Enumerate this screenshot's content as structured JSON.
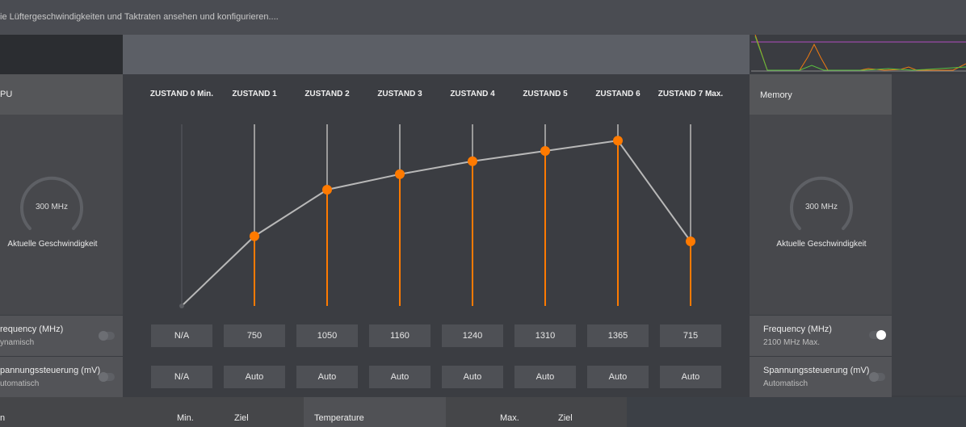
{
  "header": {
    "subtitle": "ie Lüftergeschwindigkeiten und Taktraten ansehen und konfigurieren...."
  },
  "gpu_panel": {
    "title": "PU",
    "gauge_value": "300 MHz",
    "gauge_label": "Aktuelle Geschwindigkeit",
    "frequency": {
      "title": "requency (MHz)",
      "sub": "ynamisch",
      "toggle_on": false
    },
    "voltage": {
      "title": "pannungssteuerung (mV)",
      "sub": "utomatisch",
      "toggle_on": false
    }
  },
  "memory_panel": {
    "title": "Memory",
    "gauge_value": "300 MHz",
    "gauge_label": "Aktuelle Geschwindigkeit",
    "frequency": {
      "title": "Frequency (MHz)",
      "sub": "2100 MHz Max.",
      "toggle_on": true
    },
    "voltage": {
      "title": "Spannungssteuerung (mV)",
      "sub": "Automatisch",
      "toggle_on": false
    }
  },
  "states": [
    {
      "label": "ZUSTAND 0 Min.",
      "frequency": "N/A",
      "voltage": "N/A",
      "level": 0.0,
      "active": false
    },
    {
      "label": "ZUSTAND 1",
      "frequency": "750",
      "voltage": "Auto",
      "level": 0.27,
      "active": true
    },
    {
      "label": "ZUSTAND 2",
      "frequency": "1050",
      "voltage": "Auto",
      "level": 0.45,
      "active": true
    },
    {
      "label": "ZUSTAND 3",
      "frequency": "1160",
      "voltage": "Auto",
      "level": 0.51,
      "active": true
    },
    {
      "label": "ZUSTAND 4",
      "frequency": "1240",
      "voltage": "Auto",
      "level": 0.56,
      "active": true
    },
    {
      "label": "ZUSTAND 5",
      "frequency": "1310",
      "voltage": "Auto",
      "level": 0.6,
      "active": true
    },
    {
      "label": "ZUSTAND 6",
      "frequency": "1365",
      "voltage": "Auto",
      "level": 0.64,
      "active": true
    },
    {
      "label": "ZUSTAND 7 Max.",
      "frequency": "715",
      "voltage": "Auto",
      "level": 0.25,
      "active": true
    }
  ],
  "bottom": {
    "left_label": "n",
    "min_label": "Min.",
    "target_label": "Ziel",
    "temperature_label": "Temperature",
    "max_label": "Max.",
    "target2_label": "Ziel"
  },
  "colors": {
    "accent": "#ff7a00",
    "line": "#b8b8b8",
    "track": "#9a9a9a"
  }
}
